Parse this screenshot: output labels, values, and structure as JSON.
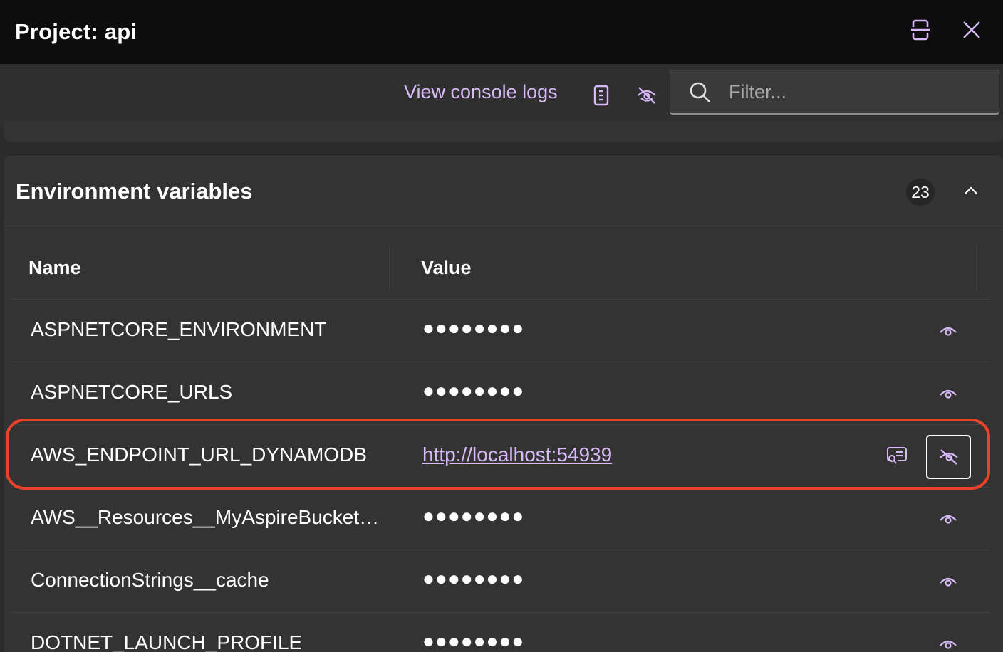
{
  "titlebar": {
    "title": "Project: api"
  },
  "toolbar": {
    "console_link": "View console logs",
    "filter_placeholder": "Filter...",
    "filter_value": ""
  },
  "env_section": {
    "heading": "Environment variables",
    "count": "23",
    "columns": {
      "name": "Name",
      "value": "Value"
    },
    "rows": [
      {
        "name": "ASPNETCORE_ENVIRONMENT",
        "value": "●●●●●●●●"
      },
      {
        "name": "ASPNETCORE_URLS",
        "value": "●●●●●●●●"
      },
      {
        "name": "AWS_ENDPOINT_URL_DYNAMODB",
        "value": "http://localhost:54939"
      },
      {
        "name": "AWS__Resources__MyAspireBucket…",
        "value": "●●●●●●●●"
      },
      {
        "name": "ConnectionStrings__cache",
        "value": "●●●●●●●●"
      },
      {
        "name": "DOTNET_LAUNCH_PROFILE",
        "value": "●●●●●●●●"
      }
    ]
  },
  "colors": {
    "accent": "#d7b9f7",
    "highlight": "#e8422a",
    "titlebar_bg": "#0d0d0d",
    "panel_bg": "#333333"
  }
}
